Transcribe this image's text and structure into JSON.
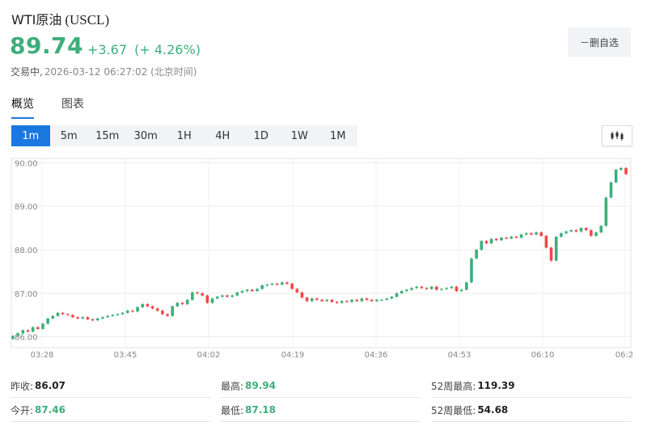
{
  "header": {
    "name": "WTI原油",
    "code": "(USCL)",
    "price": "89.74",
    "change": "+3.67",
    "change_pct": "(+ 4.26%)",
    "status": "交易中,",
    "timestamp": "2026-03-12 06:27:02 (北京时间)",
    "watch_button": "－删自选",
    "up_color": "#3dae7b",
    "down_color": "#f04848",
    "accent_color": "#1a78e0"
  },
  "tabs": [
    {
      "label": "概览",
      "active": true
    },
    {
      "label": "图表",
      "active": false
    }
  ],
  "ranges": [
    {
      "label": "1m",
      "active": true
    },
    {
      "label": "5m",
      "active": false
    },
    {
      "label": "15m",
      "active": false
    },
    {
      "label": "30m",
      "active": false
    },
    {
      "label": "1H",
      "active": false
    },
    {
      "label": "4H",
      "active": false
    },
    {
      "label": "1D",
      "active": false
    },
    {
      "label": "1W",
      "active": false
    },
    {
      "label": "1M",
      "active": false
    }
  ],
  "chart_type_icon": "candlestick-icon",
  "chart_data": {
    "type": "candlestick",
    "ylim": [
      85.75,
      90.1
    ],
    "yticks": [
      "90.00",
      "89.00",
      "88.00",
      "87.00",
      "86.00"
    ],
    "ytick_values": [
      90,
      89,
      88,
      87,
      86
    ],
    "xticks": [
      "03:28",
      "03:45",
      "04:02",
      "04:19",
      "04:36",
      "04:53",
      "06:10",
      "06:2"
    ],
    "grid": true,
    "closes": [
      86.02,
      86.08,
      86.15,
      86.12,
      86.22,
      86.18,
      86.3,
      86.42,
      86.48,
      86.55,
      86.52,
      86.5,
      86.45,
      86.42,
      86.45,
      86.4,
      86.38,
      86.42,
      86.45,
      86.48,
      86.5,
      86.52,
      86.55,
      86.6,
      86.58,
      86.68,
      86.75,
      86.7,
      86.65,
      86.6,
      86.52,
      86.48,
      86.7,
      86.78,
      86.75,
      86.85,
      87.02,
      87.0,
      86.95,
      86.78,
      86.88,
      86.92,
      86.95,
      86.92,
      86.95,
      87.02,
      87.05,
      87.08,
      87.05,
      87.1,
      87.18,
      87.2,
      87.22,
      87.2,
      87.25,
      87.22,
      87.1,
      87.02,
      86.9,
      86.82,
      86.88,
      86.85,
      86.82,
      86.85,
      86.8,
      86.78,
      86.82,
      86.8,
      86.85,
      86.82,
      86.88,
      86.85,
      86.82,
      86.85,
      86.85,
      86.88,
      86.92,
      87.0,
      87.05,
      87.08,
      87.12,
      87.15,
      87.12,
      87.1,
      87.15,
      87.08,
      87.1,
      87.12,
      87.15,
      87.05,
      87.08,
      87.25,
      87.8,
      88.0,
      88.2,
      88.15,
      88.25,
      88.22,
      88.28,
      88.26,
      88.3,
      88.28,
      88.35,
      88.38,
      88.35,
      88.4,
      88.32,
      88.05,
      87.75,
      88.3,
      88.38,
      88.42,
      88.45,
      88.42,
      88.5,
      88.45,
      88.32,
      88.4,
      88.55,
      89.2,
      89.55,
      89.84,
      89.88,
      89.74
    ]
  },
  "stats": {
    "prev_close_label": "昨收:",
    "prev_close": "86.07",
    "high_label": "最高:",
    "high": "89.94",
    "high52_label": "52周最高:",
    "high52": "119.39",
    "open_label": "今开:",
    "open": "87.46",
    "low_label": "最低:",
    "low": "87.18",
    "low52_label": "52周最低:",
    "low52": "54.68"
  }
}
